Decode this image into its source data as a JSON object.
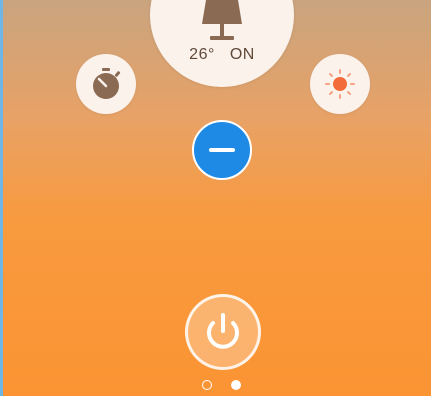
{
  "status": {
    "temperature": "26°",
    "state": "ON"
  },
  "icons": {
    "lamp": "lamp-icon",
    "timer": "timer-icon",
    "light": "sun-icon",
    "minus": "minus-icon",
    "power": "power-icon"
  },
  "colors": {
    "accent_blue": "#1e8ae6",
    "background_top": "#c9a47f",
    "background_bottom": "#fb9433",
    "button_face": "#fbf2ec",
    "timer_brown": "#8a6a53",
    "sun_orange": "#f26b3a",
    "text_brown": "#5f4a3a"
  },
  "pager": {
    "pages": 2,
    "active_page": 2
  }
}
